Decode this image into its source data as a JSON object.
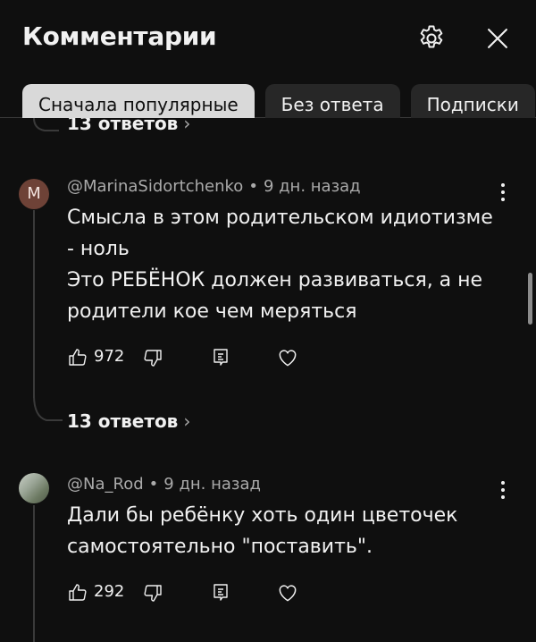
{
  "header": {
    "title": "Комментарии",
    "icons": [
      "gear-icon",
      "close-icon"
    ]
  },
  "chips": [
    {
      "label": "Сначала популярные",
      "active": true
    },
    {
      "label": "Без ответа",
      "active": false
    },
    {
      "label": "Подписки",
      "active": false
    }
  ],
  "thread_top": {
    "replies_label": "13 ответов"
  },
  "comments": [
    {
      "avatar_letter": "M",
      "author": "@MarinaSidortchenko",
      "separator": "•",
      "time": "9 дн. назад",
      "lines": [
        "Смысла в этом родительском идиотизме",
        "- ноль",
        "Это РЕБЁНОК должен развиваться, а не",
        "родители кое чем меряться"
      ],
      "likes": "972",
      "replies_label": "13 ответов"
    },
    {
      "author": "@Na_Rod",
      "separator": "•",
      "time": "9 дн. назад",
      "lines": [
        "Дали бы ребёнку хоть один цветочек",
        "самостоятельно \"поставить\"."
      ],
      "likes": "292"
    }
  ],
  "colors": {
    "background": "#0f0f0f",
    "chip_active": "#d9d9d9",
    "chip": "#272727",
    "meta": "#aaaaaa"
  }
}
